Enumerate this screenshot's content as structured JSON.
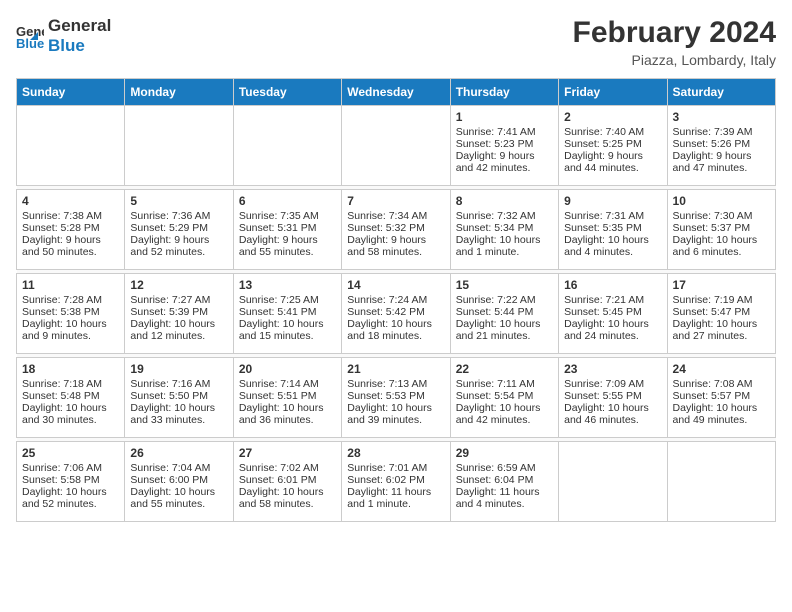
{
  "header": {
    "logo_line1": "General",
    "logo_line2": "Blue",
    "main_title": "February 2024",
    "subtitle": "Piazza, Lombardy, Italy"
  },
  "columns": [
    "Sunday",
    "Monday",
    "Tuesday",
    "Wednesday",
    "Thursday",
    "Friday",
    "Saturday"
  ],
  "weeks": [
    [
      {
        "day": "",
        "info": ""
      },
      {
        "day": "",
        "info": ""
      },
      {
        "day": "",
        "info": ""
      },
      {
        "day": "",
        "info": ""
      },
      {
        "day": "1",
        "info": "Sunrise: 7:41 AM\nSunset: 5:23 PM\nDaylight: 9 hours\nand 42 minutes."
      },
      {
        "day": "2",
        "info": "Sunrise: 7:40 AM\nSunset: 5:25 PM\nDaylight: 9 hours\nand 44 minutes."
      },
      {
        "day": "3",
        "info": "Sunrise: 7:39 AM\nSunset: 5:26 PM\nDaylight: 9 hours\nand 47 minutes."
      }
    ],
    [
      {
        "day": "4",
        "info": "Sunrise: 7:38 AM\nSunset: 5:28 PM\nDaylight: 9 hours\nand 50 minutes."
      },
      {
        "day": "5",
        "info": "Sunrise: 7:36 AM\nSunset: 5:29 PM\nDaylight: 9 hours\nand 52 minutes."
      },
      {
        "day": "6",
        "info": "Sunrise: 7:35 AM\nSunset: 5:31 PM\nDaylight: 9 hours\nand 55 minutes."
      },
      {
        "day": "7",
        "info": "Sunrise: 7:34 AM\nSunset: 5:32 PM\nDaylight: 9 hours\nand 58 minutes."
      },
      {
        "day": "8",
        "info": "Sunrise: 7:32 AM\nSunset: 5:34 PM\nDaylight: 10 hours\nand 1 minute."
      },
      {
        "day": "9",
        "info": "Sunrise: 7:31 AM\nSunset: 5:35 PM\nDaylight: 10 hours\nand 4 minutes."
      },
      {
        "day": "10",
        "info": "Sunrise: 7:30 AM\nSunset: 5:37 PM\nDaylight: 10 hours\nand 6 minutes."
      }
    ],
    [
      {
        "day": "11",
        "info": "Sunrise: 7:28 AM\nSunset: 5:38 PM\nDaylight: 10 hours\nand 9 minutes."
      },
      {
        "day": "12",
        "info": "Sunrise: 7:27 AM\nSunset: 5:39 PM\nDaylight: 10 hours\nand 12 minutes."
      },
      {
        "day": "13",
        "info": "Sunrise: 7:25 AM\nSunset: 5:41 PM\nDaylight: 10 hours\nand 15 minutes."
      },
      {
        "day": "14",
        "info": "Sunrise: 7:24 AM\nSunset: 5:42 PM\nDaylight: 10 hours\nand 18 minutes."
      },
      {
        "day": "15",
        "info": "Sunrise: 7:22 AM\nSunset: 5:44 PM\nDaylight: 10 hours\nand 21 minutes."
      },
      {
        "day": "16",
        "info": "Sunrise: 7:21 AM\nSunset: 5:45 PM\nDaylight: 10 hours\nand 24 minutes."
      },
      {
        "day": "17",
        "info": "Sunrise: 7:19 AM\nSunset: 5:47 PM\nDaylight: 10 hours\nand 27 minutes."
      }
    ],
    [
      {
        "day": "18",
        "info": "Sunrise: 7:18 AM\nSunset: 5:48 PM\nDaylight: 10 hours\nand 30 minutes."
      },
      {
        "day": "19",
        "info": "Sunrise: 7:16 AM\nSunset: 5:50 PM\nDaylight: 10 hours\nand 33 minutes."
      },
      {
        "day": "20",
        "info": "Sunrise: 7:14 AM\nSunset: 5:51 PM\nDaylight: 10 hours\nand 36 minutes."
      },
      {
        "day": "21",
        "info": "Sunrise: 7:13 AM\nSunset: 5:53 PM\nDaylight: 10 hours\nand 39 minutes."
      },
      {
        "day": "22",
        "info": "Sunrise: 7:11 AM\nSunset: 5:54 PM\nDaylight: 10 hours\nand 42 minutes."
      },
      {
        "day": "23",
        "info": "Sunrise: 7:09 AM\nSunset: 5:55 PM\nDaylight: 10 hours\nand 46 minutes."
      },
      {
        "day": "24",
        "info": "Sunrise: 7:08 AM\nSunset: 5:57 PM\nDaylight: 10 hours\nand 49 minutes."
      }
    ],
    [
      {
        "day": "25",
        "info": "Sunrise: 7:06 AM\nSunset: 5:58 PM\nDaylight: 10 hours\nand 52 minutes."
      },
      {
        "day": "26",
        "info": "Sunrise: 7:04 AM\nSunset: 6:00 PM\nDaylight: 10 hours\nand 55 minutes."
      },
      {
        "day": "27",
        "info": "Sunrise: 7:02 AM\nSunset: 6:01 PM\nDaylight: 10 hours\nand 58 minutes."
      },
      {
        "day": "28",
        "info": "Sunrise: 7:01 AM\nSunset: 6:02 PM\nDaylight: 11 hours\nand 1 minute."
      },
      {
        "day": "29",
        "info": "Sunrise: 6:59 AM\nSunset: 6:04 PM\nDaylight: 11 hours\nand 4 minutes."
      },
      {
        "day": "",
        "info": ""
      },
      {
        "day": "",
        "info": ""
      }
    ]
  ]
}
